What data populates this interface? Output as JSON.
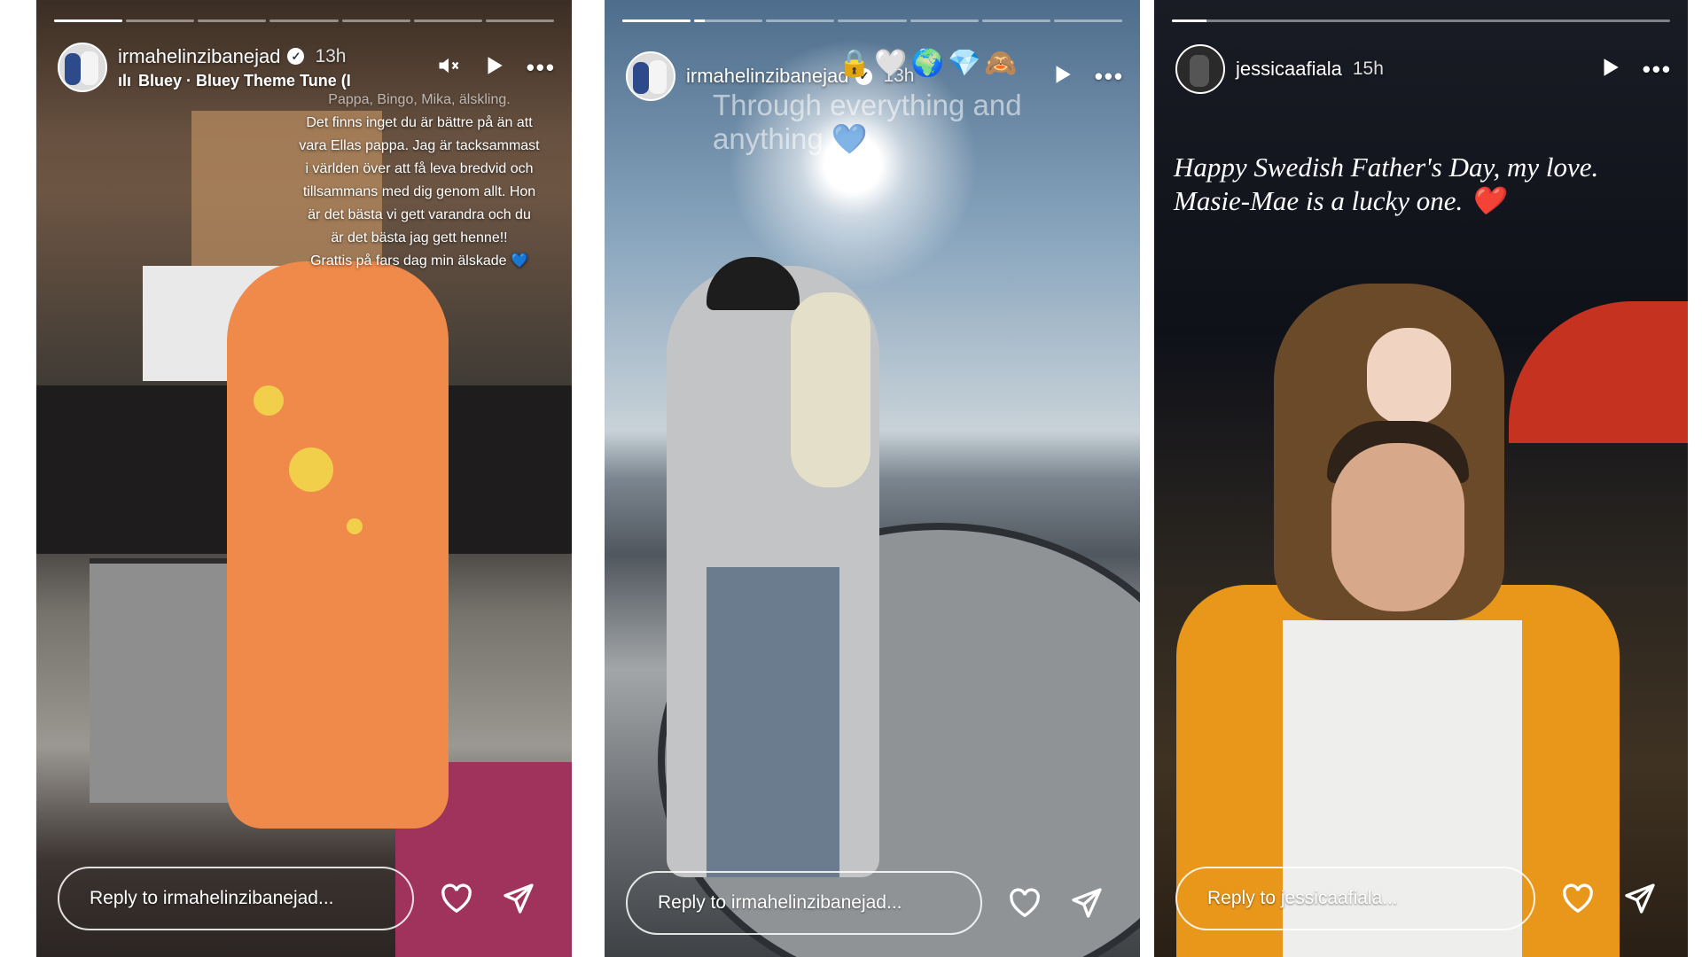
{
  "stories": [
    {
      "id": "story-1",
      "username": "irmahelinzibanejad",
      "verified": true,
      "time": "13h",
      "music": "Bluey · Bluey Theme Tune (I",
      "progress_segments": 7,
      "active_segment": 1,
      "active_fill": 1.0,
      "caption_lines": [
        "Pappa, Bingo, Mika, älskling.",
        "Det finns inget du är bättre på än att",
        "vara Ellas pappa. Jag är tacksammast",
        "i världen över att få leva bredvid och",
        "tillsammans med dig genom allt. Hon",
        "är det bästa vi gett varandra och du",
        "är det bästa jag gett henne!!",
        "Grattis på fars dag min älskade 💙"
      ],
      "reply_placeholder": "Reply to irmahelinzibanejad..."
    },
    {
      "id": "story-2",
      "username": "irmahelinzibanejad",
      "verified": true,
      "time": "13h",
      "emojis": "🔒🤍🌍💎🙈",
      "overlay_text": "Through everything and anything 💙",
      "progress_segments": 7,
      "active_segment": 1,
      "active_fill": 1.0,
      "second_fill": 0.15,
      "reply_placeholder": "Reply to irmahelinzibanejad..."
    },
    {
      "id": "story-3",
      "username": "jessicaafiala",
      "verified": false,
      "time": "15h",
      "quote_lines": [
        "Happy Swedish Father's Day, my love.",
        "Masie-Mae is a lucky one. ❤️"
      ],
      "progress_segments": 1,
      "active_segment": 1,
      "active_fill": 0.07,
      "reply_placeholder": "Reply to jessicaafiala..."
    }
  ],
  "icons": {
    "mute": "speaker-muted-icon",
    "play": "play-icon",
    "more": "more-options-icon",
    "like": "heart-icon",
    "share": "send-icon"
  }
}
